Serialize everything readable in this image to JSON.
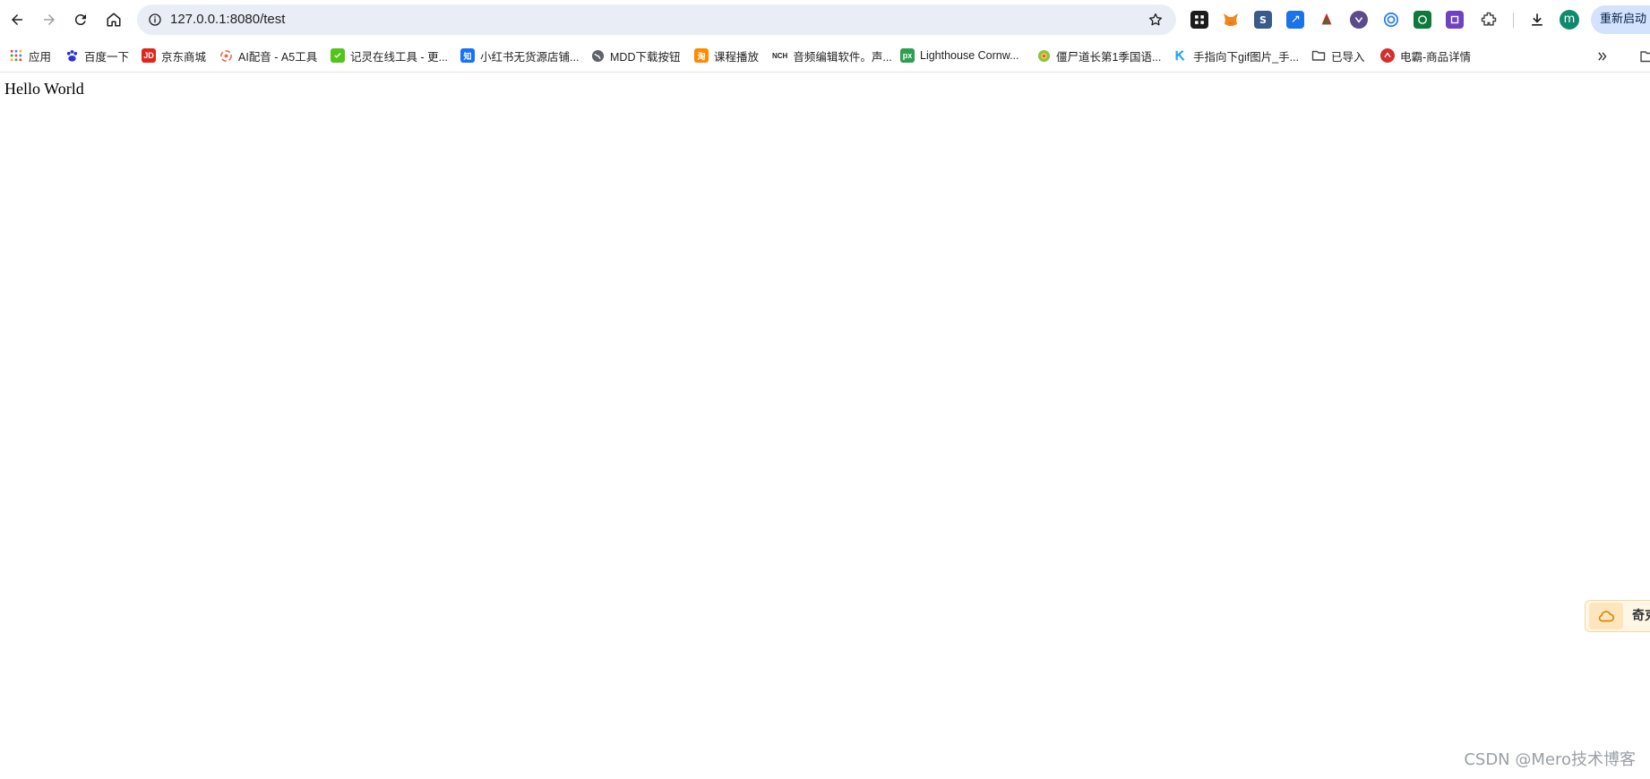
{
  "toolbar": {
    "url": "127.0.0.1:8080/test",
    "avatar_letter": "m",
    "restart_label": "重新启动",
    "extensions": [
      {
        "icon": "puzzle-dark-icon",
        "color": "#1b1b1b"
      },
      {
        "icon": "metamask-fox-icon",
        "color": "#f6851b"
      },
      {
        "icon": "s-box-icon",
        "color": "#3a5a8c"
      },
      {
        "icon": "link-icon",
        "color": "#1a73e8"
      },
      {
        "icon": "leaf-red-icon",
        "color": "#c62828"
      },
      {
        "icon": "shield-purple-icon",
        "color": "#5b4b8a"
      },
      {
        "icon": "target-blue-icon",
        "color": "#2f80ed"
      },
      {
        "icon": "green-circle-icon",
        "color": "#0c7a3a"
      },
      {
        "icon": "purple-square-icon",
        "color": "#6f42c1"
      },
      {
        "icon": "extensions-puzzle-icon",
        "color": "#444746"
      }
    ]
  },
  "bookmarks": [
    {
      "label": "应用",
      "icon": "apps-grid-icon",
      "color": "#ea4335"
    },
    {
      "label": "百度一下",
      "icon": "baidu-paw-icon",
      "color": "#2932e1"
    },
    {
      "label": "京东商城",
      "icon": "jd-icon",
      "color": "#e1251b"
    },
    {
      "label": "AI配音 - A5工具",
      "icon": "swirl-icon",
      "color": "#e8643c"
    },
    {
      "label": "记灵在线工具 - 更...",
      "icon": "green-square-icon",
      "color": "#52c41a"
    },
    {
      "label": "小红书无货源店铺...",
      "icon": "zhihu-icon",
      "color": "#1772f6"
    },
    {
      "label": "MDD下载按钮",
      "icon": "globe-icon",
      "color": "#5f6368"
    },
    {
      "label": "课程播放",
      "icon": "orange-square-icon",
      "color": "#ff8a00"
    },
    {
      "label": "音频编辑软件。声...",
      "icon": "nch-icon",
      "color": "#b00020"
    },
    {
      "label": "Lighthouse Cornw...",
      "icon": "px-icon",
      "color": "#2e9e4f"
    },
    {
      "label": "僵尸道长第1季国语...",
      "icon": "colorful-circle-icon",
      "color": "#8bc34a"
    },
    {
      "label": "手指向下gif图片_手...",
      "icon": "k-icon",
      "color": "#1aa3ff"
    },
    {
      "label": "已导入",
      "icon": "folder-icon",
      "color": "#5f6368"
    },
    {
      "label": "电霸-商品详情",
      "icon": "red-badge-icon",
      "color": "#d32f2f"
    }
  ],
  "content": {
    "hello_text": "Hello World",
    "widget_label": "奇克",
    "watermark": "CSDN @Mero技术博客"
  }
}
